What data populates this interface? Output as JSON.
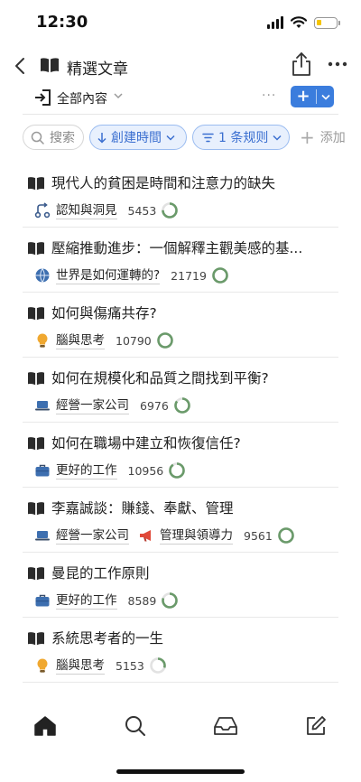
{
  "status": {
    "time": "12:30"
  },
  "nav": {
    "title": "精選文章",
    "title_icon": "book-open-icon",
    "back_icon": "chevron-left-icon",
    "share_icon": "share-icon",
    "more_icon": "more-horizontal-icon"
  },
  "view": {
    "label": "全部內容",
    "icon": "exit-door-icon",
    "more": "···",
    "add": "+"
  },
  "filters": {
    "search": "搜索",
    "sort": "創建時間",
    "rule": "1 条规则",
    "add": "添加"
  },
  "colors": {
    "accent": "#3b7ddd",
    "ring": "#6a9a6a",
    "chip_bg": "#e8f0fd",
    "chip_text": "#3b6fd0"
  },
  "articles": [
    {
      "title": "現代人的貧困是時間和注意力的缺失",
      "tags": [
        {
          "label": "認知與洞見",
          "icon": "node-link-icon"
        }
      ],
      "count": "5453",
      "progress": 0.75
    },
    {
      "title": "壓縮推動進步：一個解釋主觀美感的基...",
      "tags": [
        {
          "label": "世界是如何運轉的?",
          "icon": "globe-icon"
        }
      ],
      "count": "21719",
      "progress": 1.0
    },
    {
      "title": "如何與傷痛共存?",
      "tags": [
        {
          "label": "腦與思考",
          "icon": "lightbulb-icon"
        }
      ],
      "count": "10790",
      "progress": 1.0
    },
    {
      "title": "如何在規模化和品質之間找到平衡?",
      "tags": [
        {
          "label": "經營一家公司",
          "icon": "laptop-icon"
        }
      ],
      "count": "6976",
      "progress": 0.85
    },
    {
      "title": "如何在職場中建立和恢復信任?",
      "tags": [
        {
          "label": "更好的工作",
          "icon": "briefcase-icon"
        }
      ],
      "count": "10956",
      "progress": 0.9
    },
    {
      "title": "李嘉誠談：賺錢、奉獻、管理",
      "tags": [
        {
          "label": "經營一家公司",
          "icon": "laptop-icon"
        },
        {
          "label": "管理與領導力",
          "icon": "megaphone-icon"
        }
      ],
      "count": "9561",
      "progress": 1.0
    },
    {
      "title": "曼昆的工作原則",
      "tags": [
        {
          "label": "更好的工作",
          "icon": "briefcase-icon"
        }
      ],
      "count": "8589",
      "progress": 0.8
    },
    {
      "title": "系統思考者的一生",
      "tags": [
        {
          "label": "腦與思考",
          "icon": "lightbulb-icon"
        }
      ],
      "count": "5153",
      "progress": 0.3
    }
  ],
  "tabs": [
    {
      "name": "home-icon"
    },
    {
      "name": "search-icon"
    },
    {
      "name": "inbox-icon"
    },
    {
      "name": "edit-icon"
    }
  ]
}
